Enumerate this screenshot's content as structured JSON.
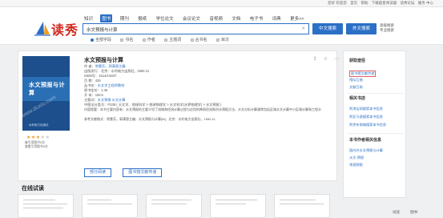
{
  "topbar": {
    "links": [
      "您好 欢迎您",
      "首页",
      "帮助",
      "下载超星阅读器",
      "读秀论坛",
      "服务 中心"
    ]
  },
  "logo": {
    "text": "读秀"
  },
  "nav": {
    "tabs": [
      "知识",
      "图书",
      "期刊",
      "报纸",
      "学位论文",
      "会议论文",
      "音视频",
      "文档",
      "电子书",
      "词典",
      "更多>>"
    ],
    "active_index": 1
  },
  "search": {
    "value": "水文预报与计算",
    "in_site_label": "中文搜索",
    "external_label": "外文搜索",
    "advanced_label": "高级搜索",
    "professional_label": "专业搜索"
  },
  "scope": {
    "options": [
      "全部字段",
      "书名",
      "作者",
      "主题词",
      "丛书名",
      "目次"
    ],
    "selected_index": 0
  },
  "book": {
    "title": "水文预报与计算",
    "cover_title": "水文预报与计算",
    "cover_watermark": "www.duxiu.com",
    "cover_subtitle": "水利电力出版社",
    "rating": 3,
    "rating_max": 5,
    "cover_meta": "被引用图书0次\n查看引用图书0次",
    "fields": [
      {
        "k": "作 者：",
        "v": "常慧芳，郭满恩主编"
      },
      {
        "k": "出版发行：",
        "v": "北京：水利电力出版社 , 1982.11"
      },
      {
        "k": "ISBN号：",
        "v": "15143-5037"
      },
      {
        "k": "页 数：",
        "v": "426"
      },
      {
        "k": "丛书名：",
        "v": "水文学工程师教材"
      },
      {
        "k": "原书定价：",
        "v": "1.45"
      },
      {
        "k": "开 本：",
        "v": "19cm"
      },
      {
        "k": "主题词：",
        "v": "水文预报 水文计算"
      },
      {
        "k": "中图法分类号：",
        "v": "P338 ( 天文学、地球科学 > 地球物理学 > 水文科学(水界物理学) > 水文预报 )"
      }
    ],
    "summary": "内容提要：本书主要内容有：水文预报的主要介绍了流域和径流计算过程与应用的降雨径流和洪水预报方法，水文分析计算通常包括区域水文计算中小区域计算和工程水文常用的一般计算及其基本原理...",
    "reference": "参考文献格式：常慧芳，郭满恩主编．水文预报与计算[M]．北京：水利电力出版社，1982.11."
  },
  "actions": {
    "read_label": "部分阅读",
    "transfer_label": "图书馆文献传递"
  },
  "toolbar_icons": [
    "share-icon",
    "favorite-icon",
    "more-icon"
  ],
  "side": {
    "get_heading": "获取途径",
    "get_items": [
      "图书馆文献传递",
      "馆际互借",
      "文献互助"
    ],
    "library_heading": "相关书店",
    "library_items": [
      "到淘宝网搜索本书信息",
      "到亚马逊搜索本书信息",
      "到京东商城搜索本书信息"
    ],
    "related_heading": "本书作者相关信息",
    "related_items": [
      "国内外水文预报与计算",
      "水文·预报",
      "常规预报"
    ]
  },
  "reading": {
    "title": "在线试读"
  },
  "taskbar": {
    "items": [
      "试读",
      "图书"
    ]
  }
}
